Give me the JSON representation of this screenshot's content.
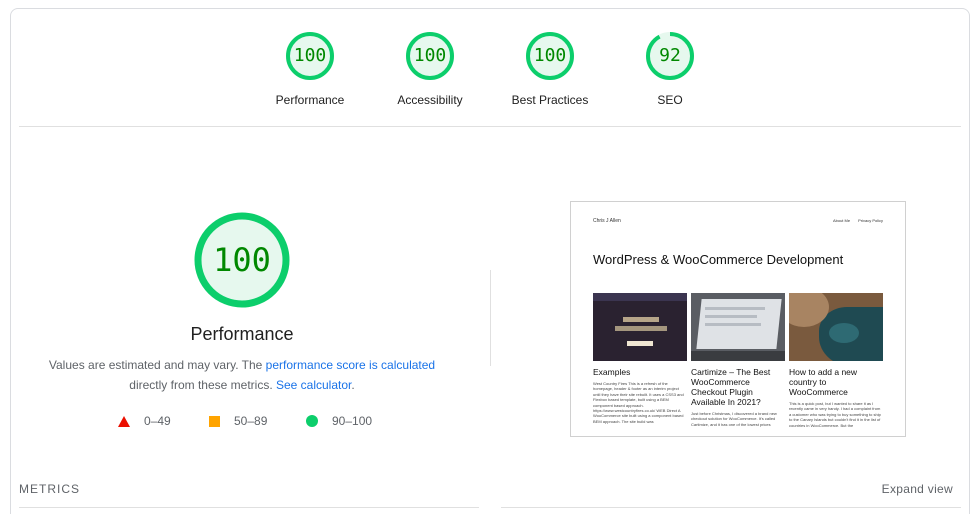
{
  "colors": {
    "pass": "#0cce6b",
    "pass_fill": "#e6f8ee",
    "pass_text": "#008800",
    "average": "#ffa400",
    "fail": "#eb0f00",
    "link": "#1a73e8"
  },
  "gauges": [
    {
      "score": "100",
      "label": "Performance",
      "fraction": 1.0
    },
    {
      "score": "100",
      "label": "Accessibility",
      "fraction": 1.0
    },
    {
      "score": "100",
      "label": "Best Practices",
      "fraction": 1.0
    },
    {
      "score": "92",
      "label": "SEO",
      "fraction": 0.92
    }
  ],
  "main": {
    "score": "100",
    "fraction": 1.0,
    "title": "Performance",
    "desc_prefix": "Values are estimated and may vary. The ",
    "desc_link1": "performance score is calculated",
    "desc_middle": "directly from these metrics. ",
    "desc_link2": "See calculator",
    "desc_suffix": "."
  },
  "legend": [
    {
      "icon": "triangle-icon",
      "range": "0–49"
    },
    {
      "icon": "square-icon",
      "range": "50–89"
    },
    {
      "icon": "circle-icon",
      "range": "90–100"
    }
  ],
  "screenshot": {
    "site_name": "Chris J Allen",
    "nav": [
      "About Me",
      "Privacy Policy"
    ],
    "site_title": "WordPress & WooCommerce Development",
    "cards": [
      {
        "title": "Examples",
        "text": "West Country Fires This is a refresh of the homepage, header & footer as an interim project until they have their site rebuilt. It uses a CSS3 and Flexbox based template, built using a BEM component based approach. https://www.westcountryfires.co.uk/ WEB Direct A WooCommerce site built using a component based BEM approach. The site build was"
      },
      {
        "title": "Cartimize – The Best WooCommerce Checkout Plugin Available In 2021?",
        "text": "Just before Christmas, I discovered a brand new checkout solution for WooCommerce. It's called Cartimize, and it has one of the lowest prices"
      },
      {
        "title": "How to add a new country to WooCommerce",
        "text": "This is a quick post, but I wanted to share it as I recently came in very handy. I had a complaint from a customer who was trying to buy something to ship to the Canary Islands but couldn't find it in the list of countries in WooCommerce. But the"
      }
    ]
  },
  "metrics_label": "METRICS",
  "expand_label": "Expand view"
}
